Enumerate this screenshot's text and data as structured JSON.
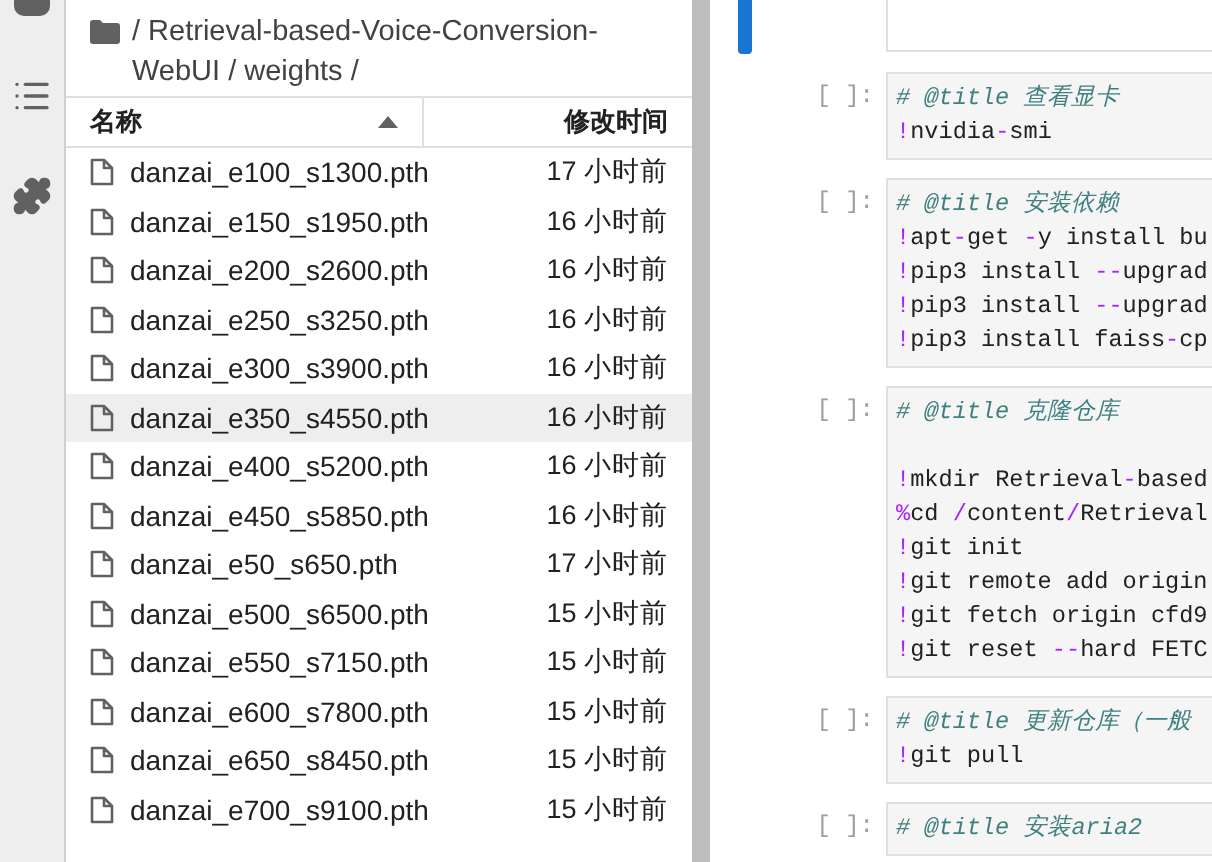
{
  "file_browser": {
    "breadcrumb": "/ Retrieval-based-Voice-Conversion-WebUI / weights /",
    "columns": [
      {
        "label": "名称",
        "sorted": true
      },
      {
        "label": "修改时间",
        "sorted": false
      }
    ],
    "files": [
      {
        "name": "danzai_e100_s1300.pth",
        "modified": "17 小时前",
        "selected": false
      },
      {
        "name": "danzai_e150_s1950.pth",
        "modified": "16 小时前",
        "selected": false
      },
      {
        "name": "danzai_e200_s2600.pth",
        "modified": "16 小时前",
        "selected": false
      },
      {
        "name": "danzai_e250_s3250.pth",
        "modified": "16 小时前",
        "selected": false
      },
      {
        "name": "danzai_e300_s3900.pth",
        "modified": "16 小时前",
        "selected": false
      },
      {
        "name": "danzai_e350_s4550.pth",
        "modified": "16 小时前",
        "selected": true
      },
      {
        "name": "danzai_e400_s5200.pth",
        "modified": "16 小时前",
        "selected": false
      },
      {
        "name": "danzai_e450_s5850.pth",
        "modified": "16 小时前",
        "selected": false
      },
      {
        "name": "danzai_e50_s650.pth",
        "modified": "17 小时前",
        "selected": false
      },
      {
        "name": "danzai_e500_s6500.pth",
        "modified": "15 小时前",
        "selected": false
      },
      {
        "name": "danzai_e550_s7150.pth",
        "modified": "15 小时前",
        "selected": false
      },
      {
        "name": "danzai_e600_s7800.pth",
        "modified": "15 小时前",
        "selected": false
      },
      {
        "name": "danzai_e650_s8450.pth",
        "modified": "15 小时前",
        "selected": false
      },
      {
        "name": "danzai_e700_s9100.pth",
        "modified": "15 小时前",
        "selected": false
      }
    ]
  },
  "notebook": {
    "cells": [
      {
        "selected": true
      },
      {
        "selected": false,
        "prompt": "[ ]:",
        "lines": [
          [
            {
              "kind": "comment",
              "text": "# @title 查看显卡"
            }
          ],
          [
            {
              "kind": "op",
              "text": "!"
            },
            {
              "kind": "plain",
              "text": "nvidia"
            },
            {
              "kind": "op",
              "text": "-"
            },
            {
              "kind": "plain",
              "text": "smi"
            }
          ]
        ]
      },
      {
        "selected": false,
        "prompt": "[ ]:",
        "lines": [
          [
            {
              "kind": "comment",
              "text": "# @title 安装依赖"
            }
          ],
          [
            {
              "kind": "op",
              "text": "!"
            },
            {
              "kind": "plain",
              "text": "apt"
            },
            {
              "kind": "op",
              "text": "-"
            },
            {
              "kind": "plain",
              "text": "get "
            },
            {
              "kind": "op",
              "text": "-"
            },
            {
              "kind": "plain",
              "text": "y install bu"
            }
          ],
          [
            {
              "kind": "op",
              "text": "!"
            },
            {
              "kind": "plain",
              "text": "pip3 install "
            },
            {
              "kind": "op",
              "text": "--"
            },
            {
              "kind": "plain",
              "text": "upgrad"
            }
          ],
          [
            {
              "kind": "op",
              "text": "!"
            },
            {
              "kind": "plain",
              "text": "pip3 install "
            },
            {
              "kind": "op",
              "text": "--"
            },
            {
              "kind": "plain",
              "text": "upgrad"
            }
          ],
          [
            {
              "kind": "op",
              "text": "!"
            },
            {
              "kind": "plain",
              "text": "pip3 install faiss"
            },
            {
              "kind": "op",
              "text": "-"
            },
            {
              "kind": "plain",
              "text": "cp"
            }
          ]
        ]
      },
      {
        "selected": false,
        "prompt": "[ ]:",
        "blank_after_title": true,
        "lines": [
          [
            {
              "kind": "comment",
              "text": "# @title 克隆仓库"
            }
          ],
          [
            {
              "kind": "op",
              "text": "!"
            },
            {
              "kind": "plain",
              "text": "mkdir Retrieval"
            },
            {
              "kind": "op",
              "text": "-"
            },
            {
              "kind": "plain",
              "text": "based"
            }
          ],
          [
            {
              "kind": "op",
              "text": "%"
            },
            {
              "kind": "plain",
              "text": "cd "
            },
            {
              "kind": "op",
              "text": "/"
            },
            {
              "kind": "plain",
              "text": "content"
            },
            {
              "kind": "op",
              "text": "/"
            },
            {
              "kind": "plain",
              "text": "Retrieval"
            }
          ],
          [
            {
              "kind": "op",
              "text": "!"
            },
            {
              "kind": "plain",
              "text": "git init"
            }
          ],
          [
            {
              "kind": "op",
              "text": "!"
            },
            {
              "kind": "plain",
              "text": "git remote add origin"
            }
          ],
          [
            {
              "kind": "op",
              "text": "!"
            },
            {
              "kind": "plain",
              "text": "git fetch origin cfd9"
            }
          ],
          [
            {
              "kind": "op",
              "text": "!"
            },
            {
              "kind": "plain",
              "text": "git reset "
            },
            {
              "kind": "op",
              "text": "--"
            },
            {
              "kind": "plain",
              "text": "hard FETC"
            }
          ]
        ]
      },
      {
        "selected": false,
        "prompt": "[ ]:",
        "lines": [
          [
            {
              "kind": "comment",
              "text": "# @title 更新仓库（一般"
            }
          ],
          [
            {
              "kind": "op",
              "text": "!"
            },
            {
              "kind": "plain",
              "text": "git pull"
            }
          ]
        ]
      },
      {
        "selected": false,
        "prompt": "[ ]:",
        "lines": [
          [
            {
              "kind": "comment",
              "text": "# @title 安装aria2"
            }
          ]
        ]
      }
    ]
  }
}
